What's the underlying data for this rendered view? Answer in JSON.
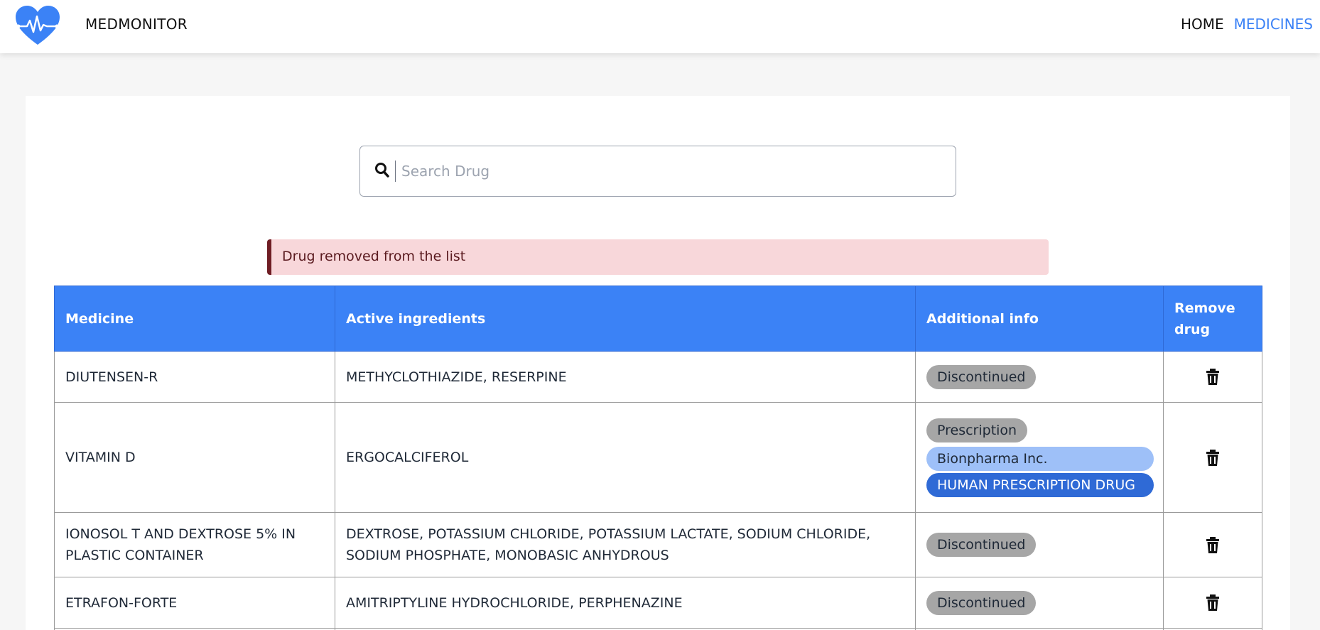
{
  "navbar": {
    "brand": "MEDMONITOR",
    "links": [
      "HOME",
      "MEDICINES"
    ],
    "active": "MEDICINES"
  },
  "search": {
    "placeholder": "Search Drug",
    "value": ""
  },
  "alert": {
    "message": "Drug removed from the list"
  },
  "table": {
    "headers": [
      "Medicine",
      "Active ingredients",
      "Additional info",
      "Remove drug"
    ],
    "rows": [
      {
        "medicine": "DIUTENSEN-R",
        "ingredients": "METHYCLOTHIAZIDE, RESERPINE",
        "badges": [
          "Discontinued"
        ]
      },
      {
        "medicine": "VITAMIN D",
        "ingredients": "ERGOCALCIFEROL",
        "badges": [
          "Prescription",
          "Bionpharma Inc.",
          "HUMAN PRESCRIPTION DRUG"
        ]
      },
      {
        "medicine": "IONOSOL T AND DEXTROSE 5% IN PLASTIC CONTAINER",
        "ingredients": "DEXTROSE, POTASSIUM CHLORIDE, POTASSIUM LACTATE, SODIUM CHLORIDE, SODIUM PHOSPHATE, MONOBASIC ANHYDROUS",
        "badges": [
          "Discontinued"
        ]
      },
      {
        "medicine": "ETRAFON-FORTE",
        "ingredients": "AMITRIPTYLINE HYDROCHLORIDE, PERPHENAZINE",
        "badges": [
          "Discontinued"
        ]
      }
    ]
  },
  "colors": {
    "primary": "#3b82f6",
    "alert_bg": "#f8d7da",
    "badge_grey": "#a6a6a6",
    "badge_light": "#9ec0f8",
    "badge_dark": "#2f6ad6"
  },
  "icons": {
    "logo": "heart-pulse-icon",
    "search": "search-icon",
    "remove": "trash-icon"
  }
}
